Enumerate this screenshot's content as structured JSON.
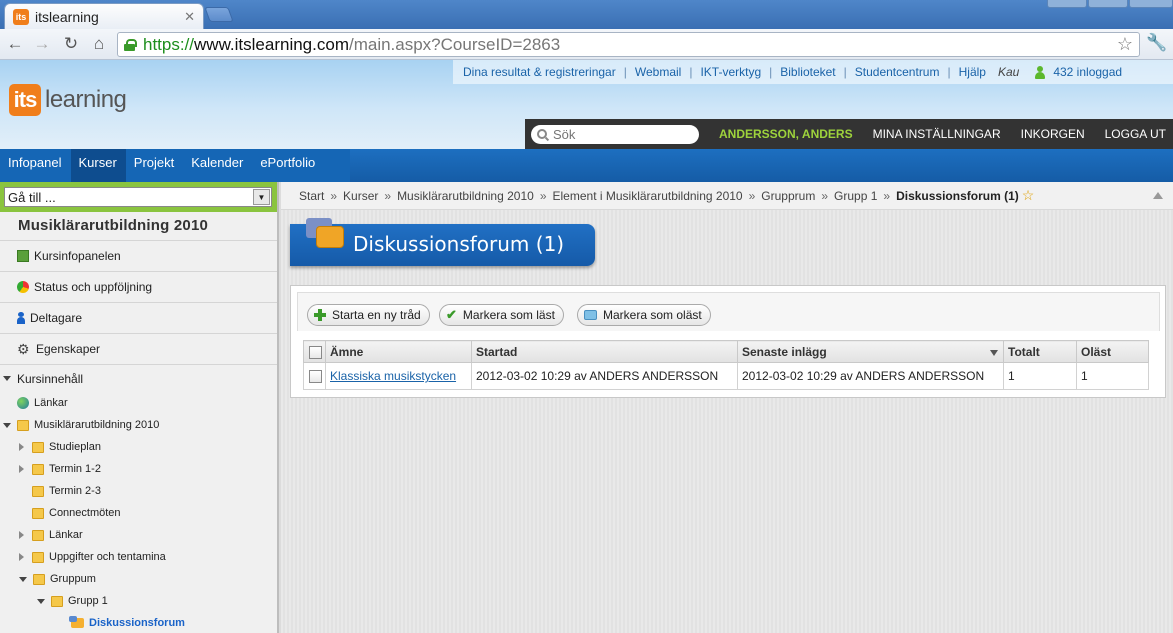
{
  "browser": {
    "tab_title": "itslearning",
    "tab_favicon": "its",
    "url_scheme": "https://",
    "url_host": "www.itslearning.com",
    "url_path": "/main.aspx?CourseID=2863"
  },
  "header": {
    "logo_its": "its",
    "logo_text": "learning",
    "top_links": [
      "Dina resultat & registreringar",
      "Webmail",
      "IKT-verktyg",
      "Biblioteket",
      "Studentcentrum",
      "Hjälp"
    ],
    "org": "Kau",
    "online": "432 inloggad",
    "search_placeholder": "Sök",
    "user_name": "ANDERSSON, ANDERS",
    "user_links": [
      "MINA INSTÄLLNINGAR",
      "INKORGEN",
      "LOGGA UT"
    ]
  },
  "nav": {
    "tabs": [
      "Infopanel",
      "Kurser",
      "Projekt",
      "Kalender",
      "ePortfolio"
    ],
    "active": "Kurser"
  },
  "sidebar": {
    "goto": "Gå till ...",
    "course_title": "Musiklärarutbildning 2010",
    "items": [
      "Kursinfopanelen",
      "Status och uppföljning",
      "Deltagare",
      "Egenskaper"
    ],
    "section": "Kursinnehåll",
    "tree": [
      "Länkar",
      "Musiklärarutbildning 2010",
      "Studieplan",
      "Termin 1-2",
      "Termin 2-3",
      "Connectmöten",
      "Länkar",
      "Uppgifter och tentamina",
      "Gruppum",
      "Grupp 1",
      "Diskussionsforum"
    ]
  },
  "breadcrumb": [
    "Start",
    "Kurser",
    "Musiklärarutbildning 2010",
    "Element i Musiklärarutbildning 2010",
    "Grupprum",
    "Grupp 1"
  ],
  "breadcrumb_current": "Diskussionsforum (1)",
  "page": {
    "title": "Diskussionsforum (1)",
    "buttons": [
      "Starta en ny tråd",
      "Markera som läst",
      "Markera som oläst"
    ],
    "columns": [
      "Ämne",
      "Startad",
      "Senaste inlägg",
      "Totalt",
      "Oläst"
    ],
    "rows": [
      {
        "subject": "Klassiska musikstycken",
        "started": "2012-03-02 10:29 av ANDERS ANDERSSON",
        "latest": "2012-03-02 10:29 av ANDERS ANDERSSON",
        "total": "1",
        "unread": "1"
      }
    ]
  }
}
